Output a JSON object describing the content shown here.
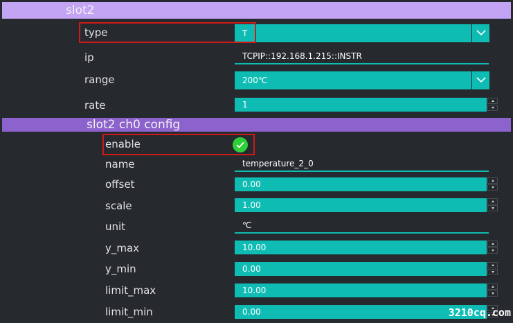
{
  "slot": {
    "header": "slot2",
    "type": {
      "label": "type",
      "value": "T"
    },
    "ip": {
      "label": "ip",
      "value": "TCPIP::192.168.1.215::INSTR"
    },
    "range": {
      "label": "range",
      "value": "200℃"
    },
    "rate": {
      "label": "rate",
      "value": "1"
    }
  },
  "channel": {
    "header": "slot2 ch0 config",
    "enable": {
      "label": "enable",
      "checked": true
    },
    "name": {
      "label": "name",
      "value": "temperature_2_0"
    },
    "offset": {
      "label": "offset",
      "value": "0.00"
    },
    "scale": {
      "label": "scale",
      "value": "1.00"
    },
    "unit": {
      "label": "unit",
      "value": "℃"
    },
    "y_max": {
      "label": "y_max",
      "value": "10.00"
    },
    "y_min": {
      "label": "y_min",
      "value": "0.00"
    },
    "limit_max": {
      "label": "limit_max",
      "value": "10.00"
    },
    "limit_min": {
      "label": "limit_min",
      "value": "0.00"
    }
  },
  "watermark": "3210cq.com",
  "colors": {
    "background": "#26292d",
    "slot_header": "#c3a3f4",
    "channel_header": "#8c62cc",
    "field": "#0fbcb4",
    "highlight": "#d01a1a",
    "checkbox": "#2fcf3a"
  }
}
